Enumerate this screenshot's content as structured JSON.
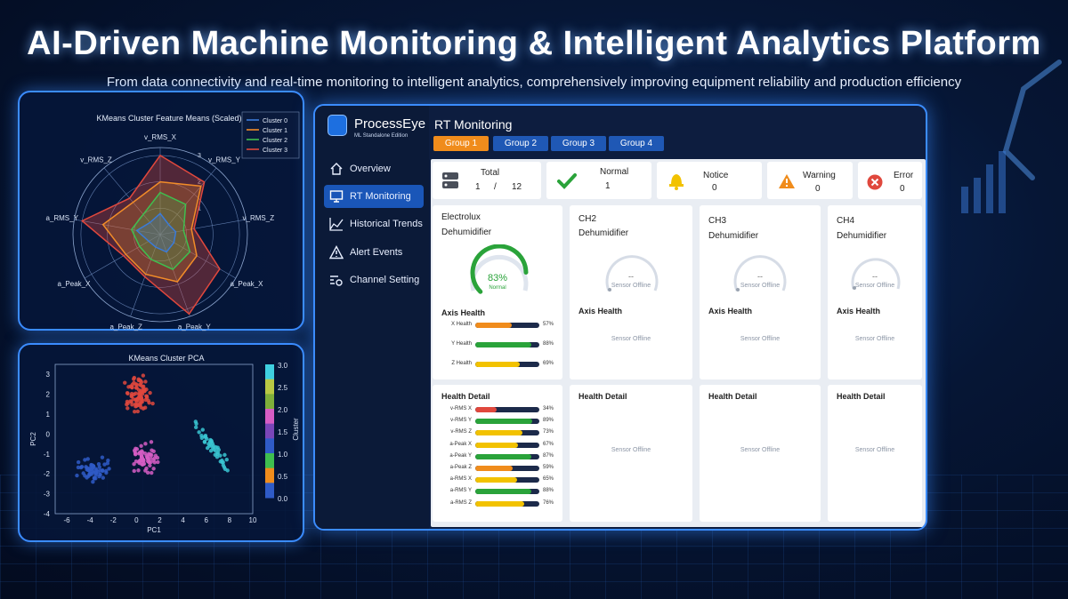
{
  "page": {
    "title": "AI-Driven Machine Monitoring & Intelligent Analytics Platform",
    "subtitle": "From data connectivity and real-time monitoring to intelligent analytics, comprehensively improving equipment reliability and production efficiency"
  },
  "colors": {
    "cluster0": "#3b7bd9",
    "cluster1": "#f28c28",
    "cluster2": "#3fbf4f",
    "cluster3": "#e0483d",
    "accent": "#1a56b8",
    "tab_active": "#f08c1c",
    "ok": "#2aa33a",
    "warn": "#f2c200"
  },
  "radar": {
    "title": "KMeans Cluster Feature Means (Scaled)",
    "axes": [
      "v_RMS_X",
      "v_RMS_Y",
      "v_RMS_Z",
      "a_Peak_X",
      "a_Peak_Y",
      "a_Peak_Z",
      "a_Peak_X",
      "a_RMS_Y",
      "v_RMS_Z"
    ],
    "axis_labels_shown": [
      "v_RMS_X",
      "v_RMS_Y",
      "v_RMS_Z",
      "a_Peak_X",
      "a_Peak_Y",
      "a_Peak_Z",
      "a_Peak_X",
      "a_RMS_Y",
      "v_RMS_Z"
    ],
    "ring_labels": [
      "1",
      "2",
      "3"
    ],
    "legend": [
      "Cluster 0",
      "Cluster 1",
      "Cluster 2",
      "Cluster 3"
    ],
    "series": [
      {
        "name": "Cluster 0",
        "values": [
          0.8,
          0.5,
          0.6,
          0.6,
          0.7,
          0.5,
          0.5,
          0.9,
          0.6
        ]
      },
      {
        "name": "Cluster 1",
        "values": [
          2.0,
          2.4,
          1.2,
          1.6,
          1.9,
          1.6,
          1.5,
          2.2,
          1.6
        ]
      },
      {
        "name": "Cluster 2",
        "values": [
          1.6,
          1.5,
          0.9,
          1.3,
          1.4,
          1.0,
          0.9,
          1.1,
          1.0
        ]
      },
      {
        "name": "Cluster 3",
        "values": [
          3.0,
          2.6,
          1.3,
          2.6,
          3.2,
          1.7,
          1.6,
          3.0,
          1.8
        ]
      }
    ]
  },
  "chart_data": [
    {
      "type": "scatter",
      "title": "KMeans Cluster PCA",
      "xlabel": "PC1",
      "ylabel": "PC2",
      "xlim": [
        -7,
        10
      ],
      "ylim": [
        -4,
        3.5
      ],
      "xticks": [
        "-6",
        "-4",
        "-2",
        "0",
        "2",
        "4",
        "6",
        "8",
        "10"
      ],
      "yticks": [
        "3",
        "2",
        "1",
        "0",
        "-1",
        "-2",
        "-3",
        "-4"
      ],
      "colorbar": {
        "label": "Cluster",
        "ticks": [
          "3.0",
          "2.5",
          "2.0",
          "1.5",
          "1.0",
          "0.5",
          "0.0"
        ]
      },
      "series": [
        {
          "name": "0",
          "center": [
            -3.5,
            -1.8
          ]
        },
        {
          "name": "1",
          "center": [
            0.2,
            2.0
          ]
        },
        {
          "name": "2",
          "center": [
            0.8,
            -1.2
          ]
        },
        {
          "name": "3",
          "center": [
            6.5,
            -0.6
          ]
        }
      ]
    }
  ],
  "app": {
    "name": "ProcessEye",
    "edition": "ML Standalone Edition",
    "logo_text": "ProcessEye",
    "header": "RT Monitoring",
    "nav": [
      {
        "label": "Overview",
        "icon": "home-icon"
      },
      {
        "label": "RT Monitoring",
        "icon": "monitor-icon"
      },
      {
        "label": "Historical Trends",
        "icon": "trend-icon"
      },
      {
        "label": "Alert Events",
        "icon": "alert-icon"
      },
      {
        "label": "Channel Setting",
        "icon": "settings-icon"
      }
    ],
    "tabs": [
      "Group 1",
      "Group 2",
      "Group 3",
      "Group 4"
    ],
    "stats": {
      "total": {
        "label": "Total",
        "value": "1",
        "sep": "/",
        "of": "12"
      },
      "normal": {
        "label": "Normal",
        "value": "1"
      },
      "notice": {
        "label": "Notice",
        "value": "0"
      },
      "warning": {
        "label": "Warning",
        "value": "0"
      },
      "error": {
        "label": "Error",
        "value": "0"
      }
    },
    "channels": [
      {
        "title": "Electrolux",
        "sub": "Dehumidifier",
        "gauge_value": "83%",
        "gauge_state": "Normal",
        "gauge_fraction": 0.83
      },
      {
        "title": "CH2",
        "sub": "Dehumidifier",
        "gauge_value": "--",
        "gauge_state": "Sensor Offline"
      },
      {
        "title": "CH3",
        "sub": "Dehumidifier",
        "gauge_value": "--",
        "gauge_state": "Sensor Offline"
      },
      {
        "title": "CH4",
        "sub": "Dehumidifier",
        "gauge_value": "--",
        "gauge_state": "Sensor Offline"
      }
    ],
    "axis_health_heading": "Axis Health",
    "health_detail_heading": "Health Detail",
    "offline_text": "Sensor Offline",
    "axis_health": [
      {
        "label": "X Health",
        "value": "57%",
        "pct": 0.57,
        "color": "#f08c1c"
      },
      {
        "label": "Y Health",
        "value": "88%",
        "pct": 0.88,
        "color": "#2aa33a"
      },
      {
        "label": "Z Health",
        "value": "69%",
        "pct": 0.69,
        "color": "#f2c200"
      }
    ],
    "health_detail": [
      {
        "label": "v-RMS X",
        "value": "34%",
        "pct": 0.34,
        "color": "#e0483d"
      },
      {
        "label": "v-RMS Y",
        "value": "89%",
        "pct": 0.89,
        "color": "#2aa33a"
      },
      {
        "label": "v-RMS Z",
        "value": "73%",
        "pct": 0.73,
        "color": "#f2c200"
      },
      {
        "label": "a-Peak X",
        "value": "67%",
        "pct": 0.67,
        "color": "#f2c200"
      },
      {
        "label": "a-Peak Y",
        "value": "87%",
        "pct": 0.87,
        "color": "#2aa33a"
      },
      {
        "label": "a-Peak Z",
        "value": "59%",
        "pct": 0.59,
        "color": "#f08c1c"
      },
      {
        "label": "a-RMS X",
        "value": "65%",
        "pct": 0.65,
        "color": "#f2c200"
      },
      {
        "label": "a-RMS Y",
        "value": "88%",
        "pct": 0.88,
        "color": "#2aa33a"
      },
      {
        "label": "a-RMS Z",
        "value": "76%",
        "pct": 0.76,
        "color": "#f2c200"
      }
    ]
  }
}
